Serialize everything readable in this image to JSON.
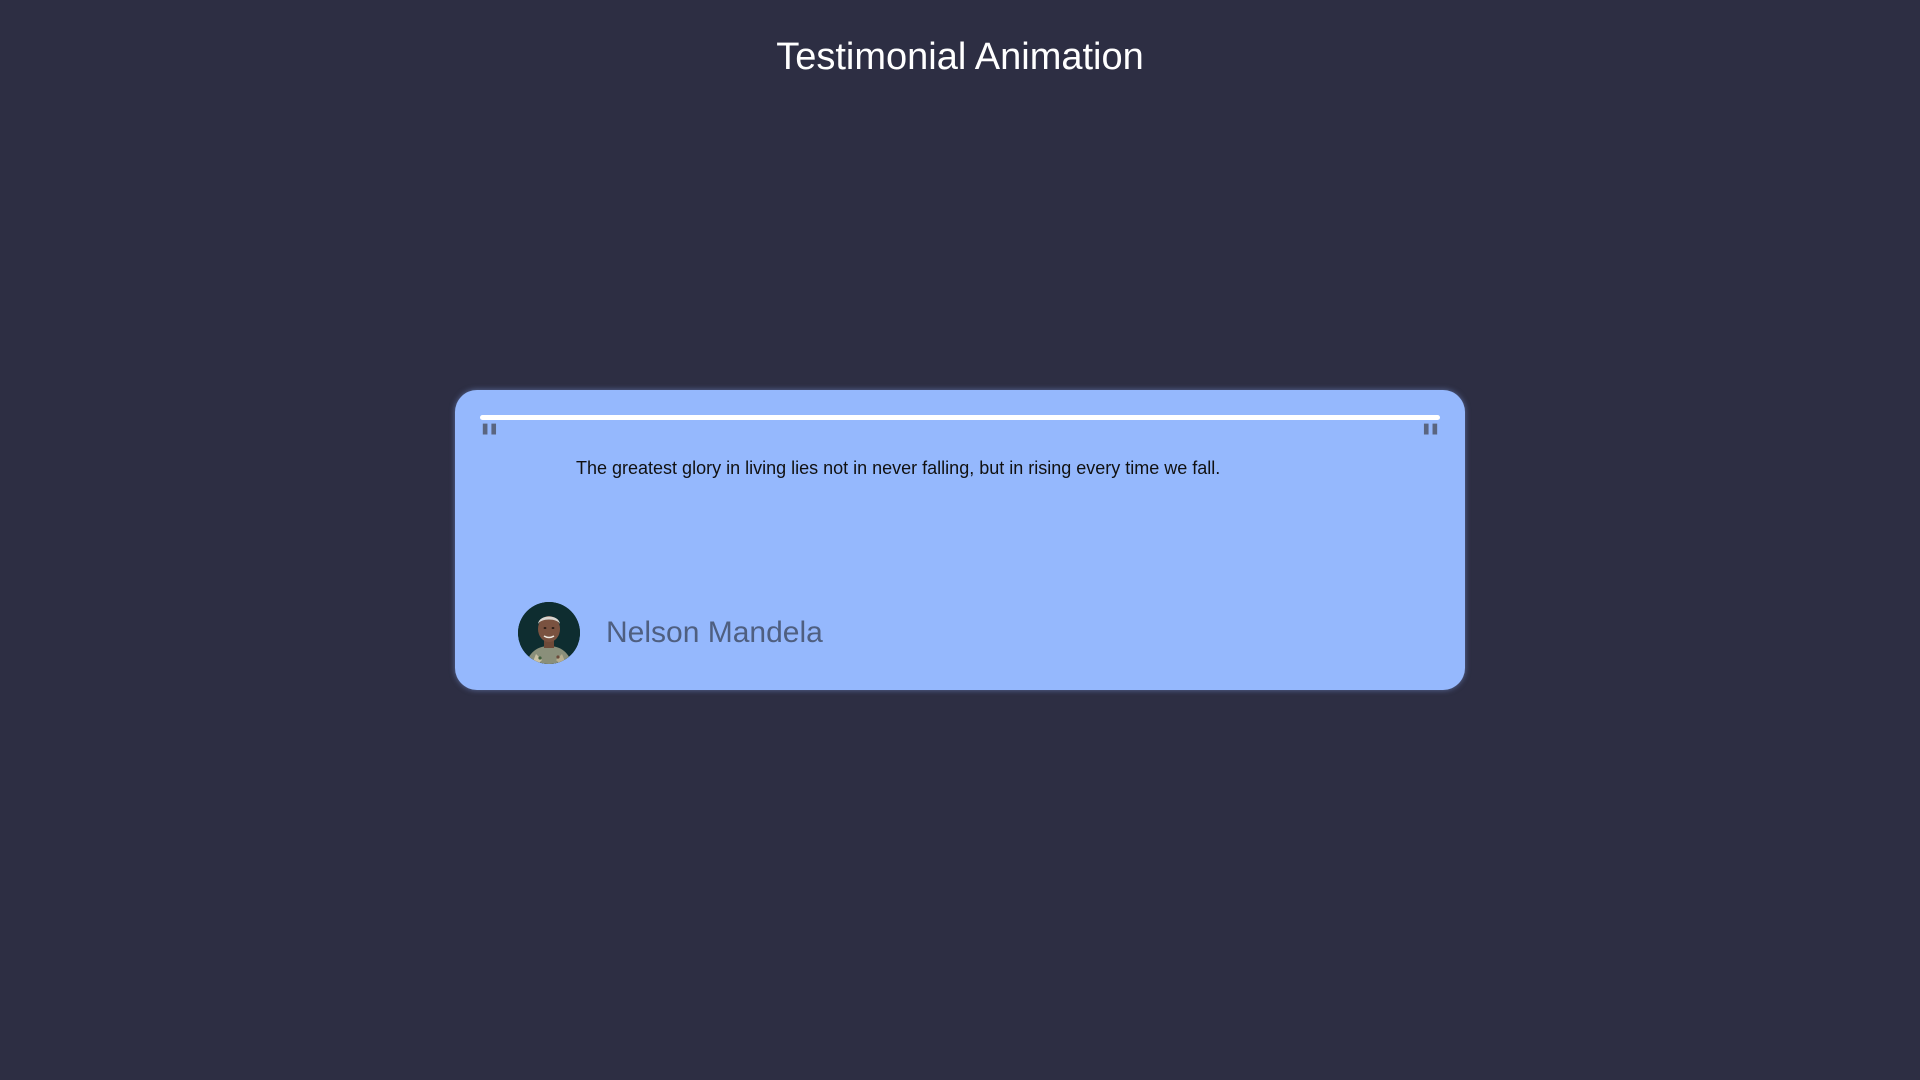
{
  "page": {
    "title": "Testimonial Animation"
  },
  "testimonial": {
    "quote": "The greatest glory in living lies not in never falling, but in rising every time we fall.",
    "author": "Nelson Mandela",
    "open_quote_glyph": "\"",
    "close_quote_glyph": "\"",
    "progress_fraction": 1.0
  },
  "colors": {
    "background": "#2d2e43",
    "card": "#95b8fd",
    "progress": "#ffffff",
    "author_text": "#4f5f80"
  },
  "icons": {
    "open_quote": "quote-open-icon",
    "close_quote": "quote-close-icon"
  }
}
